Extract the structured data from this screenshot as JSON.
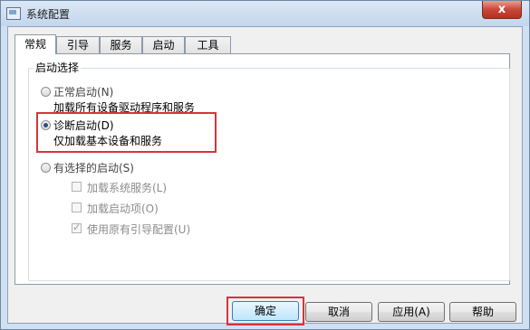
{
  "window": {
    "title": "系统配置",
    "close_glyph": "x"
  },
  "tabs": [
    {
      "label": "常规",
      "active": true
    },
    {
      "label": "引导"
    },
    {
      "label": "服务"
    },
    {
      "label": "启动"
    },
    {
      "label": "工具"
    }
  ],
  "startup_group": {
    "label": "启动选择",
    "normal": {
      "title": "正常启动(N)",
      "desc": "加载所有设备驱动程序和服务",
      "checked": false
    },
    "diagnostic": {
      "title": "诊断启动(D)",
      "desc": "仅加载基本设备和服务",
      "checked": true
    },
    "selective": {
      "title": "有选择的启动(S)",
      "checked": false,
      "options": [
        {
          "label": "加载系统服务(L)",
          "checked": false
        },
        {
          "label": "加载启动项(O)",
          "checked": false
        },
        {
          "label": "使用原有引导配置(U)",
          "checked": true
        }
      ]
    }
  },
  "buttons": {
    "ok": "确定",
    "cancel": "取消",
    "apply": "应用(A)",
    "help": "帮助"
  },
  "colors": {
    "highlight": "#d6353a",
    "close_button": "#c7483a",
    "frame": "#cfe0f1"
  }
}
